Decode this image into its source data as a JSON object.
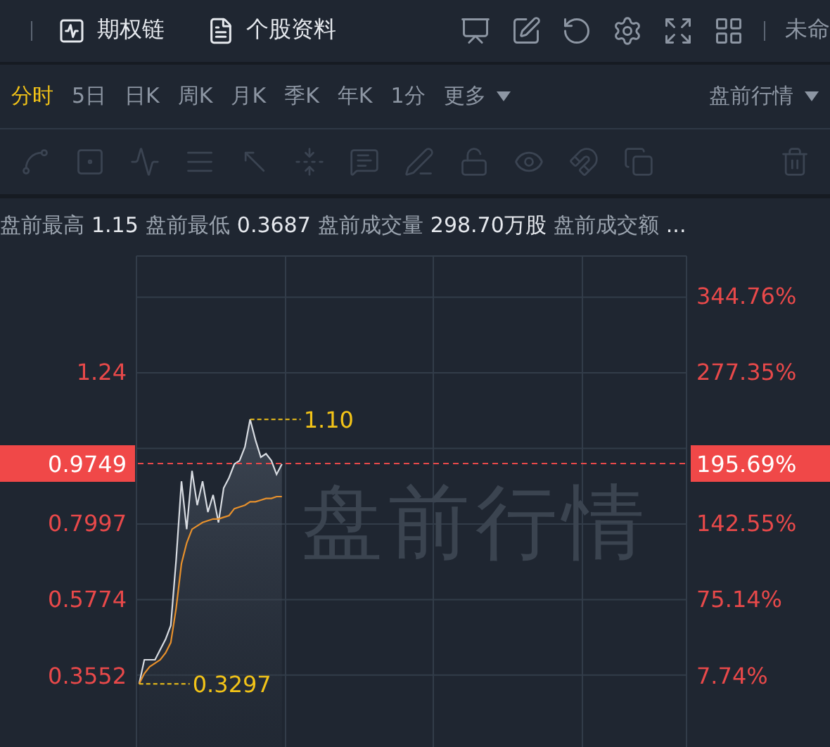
{
  "toolbar": {
    "links": [
      {
        "label": "期权链",
        "kind": "chart"
      },
      {
        "label": "个股资料",
        "kind": "doc"
      }
    ],
    "account": "未命"
  },
  "periods": [
    {
      "label": "分时",
      "selected": true
    },
    {
      "label": "5日",
      "selected": false
    },
    {
      "label": "日K",
      "selected": false
    },
    {
      "label": "周K",
      "selected": false
    },
    {
      "label": "月K",
      "selected": false
    },
    {
      "label": "季K",
      "selected": false
    },
    {
      "label": "年K",
      "selected": false
    },
    {
      "label": "1分",
      "selected": false
    },
    {
      "label": "更多",
      "selected": false,
      "dropdown": true
    }
  ],
  "session": {
    "label": "盘前行情"
  },
  "stats": [
    {
      "label": "盘前最高",
      "value": "1.15"
    },
    {
      "label": "盘前最低",
      "value": "0.3687"
    },
    {
      "label": "盘前成交量",
      "value": "298.70万股"
    },
    {
      "label": "盘前成交额",
      "value": "..."
    }
  ],
  "chart": {
    "watermark": "盘前行情",
    "current_change": "195.69%",
    "right_axis": [
      "344.76%",
      "277.35%",
      "142.55%",
      "75.14%",
      "7.74%"
    ],
    "chart_data": {
      "type": "line",
      "grid": true,
      "ylim": [
        0.146,
        1.588
      ],
      "categories": [
        null,
        null,
        null,
        null,
        null,
        null,
        null,
        null,
        null,
        null,
        null,
        null,
        null,
        null,
        null,
        null,
        null,
        null,
        null,
        null,
        null,
        null,
        null,
        null,
        null,
        null,
        null,
        null,
        null,
        null,
        null,
        null,
        null,
        null,
        null,
        null,
        null,
        null,
        null,
        null,
        null,
        null,
        null,
        null,
        null,
        null,
        null,
        null,
        null,
        null,
        null,
        null,
        null,
        null,
        null,
        null,
        null,
        null,
        null,
        null,
        null,
        null,
        null,
        null,
        null,
        null,
        null,
        null,
        null,
        null,
        null,
        null,
        null,
        null,
        null,
        null,
        null,
        null,
        null,
        null,
        null,
        null,
        null,
        null,
        null,
        null,
        null,
        null,
        null,
        null,
        null,
        null,
        null,
        null,
        null,
        null,
        null,
        null,
        null,
        null,
        null,
        null,
        null,
        null
      ],
      "yticks": [
        {
          "value": 1.24,
          "label": "1.24"
        },
        {
          "value": 0.7997,
          "label": "0.7997"
        },
        {
          "value": 0.5774,
          "label": "0.5774"
        },
        {
          "value": 0.3552,
          "label": "0.3552"
        }
      ],
      "series": [
        {
          "color": "#d8dce2",
          "values": [
            0.33,
            0.4,
            0.4,
            0.4,
            0.43,
            0.46,
            0.5,
            0.69,
            0.92,
            0.78,
            0.95,
            0.85,
            0.92,
            0.83,
            0.88,
            0.8,
            0.9,
            0.93,
            0.97,
            0.98,
            1.02,
            1.1,
            1.04,
            0.99,
            1.0,
            0.98,
            0.94,
            0.97,
            null,
            null,
            null,
            null,
            null,
            null,
            null,
            null,
            null,
            null,
            null,
            null,
            null,
            null,
            null,
            null,
            null,
            null,
            null,
            null,
            null,
            null,
            null,
            null,
            null,
            null,
            null,
            null,
            null,
            null,
            null,
            null,
            null,
            null,
            null,
            null,
            null,
            null,
            null,
            null,
            null,
            null,
            null,
            null,
            null,
            null,
            null,
            null,
            null,
            null,
            null,
            null,
            null,
            null,
            null,
            null,
            null,
            null,
            null,
            null,
            null,
            null,
            null,
            null,
            null,
            null,
            null,
            null,
            null,
            null,
            null,
            null,
            null,
            null,
            null,
            null
          ]
        },
        {
          "color": "#e8912c",
          "values": [
            0.33,
            0.36,
            0.38,
            0.39,
            0.4,
            0.42,
            0.45,
            0.55,
            0.68,
            0.74,
            0.78,
            0.79,
            0.8,
            0.805,
            0.81,
            0.81,
            0.815,
            0.82,
            0.84,
            0.845,
            0.85,
            0.86,
            0.86,
            0.865,
            0.87,
            0.87,
            0.875,
            0.875,
            null,
            null,
            null,
            null,
            null,
            null,
            null,
            null,
            null,
            null,
            null,
            null,
            null,
            null,
            null,
            null,
            null,
            null,
            null,
            null,
            null,
            null,
            null,
            null,
            null,
            null,
            null,
            null,
            null,
            null,
            null,
            null,
            null,
            null,
            null,
            null,
            null,
            null,
            null,
            null,
            null,
            null,
            null,
            null,
            null,
            null,
            null,
            null,
            null,
            null,
            null,
            null,
            null,
            null,
            null,
            null,
            null,
            null,
            null,
            null,
            null,
            null,
            null,
            null,
            null,
            null,
            null,
            null,
            null,
            null,
            null,
            null,
            null,
            null,
            null,
            null
          ]
        }
      ],
      "ref_lines": [
        {
          "axis": "y",
          "value": 0.9749,
          "label": "0.9749",
          "color": "#e8494a"
        }
      ],
      "annotations": [
        "1.10",
        "0.3297"
      ]
    }
  }
}
